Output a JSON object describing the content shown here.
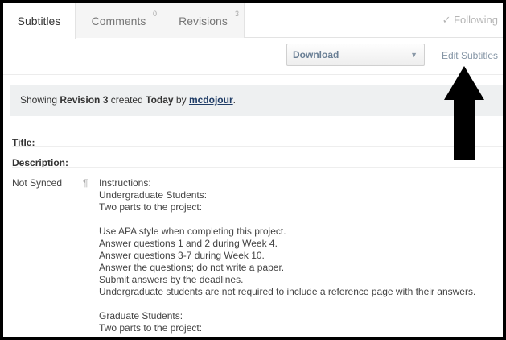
{
  "tabs": [
    {
      "label": "Subtitles",
      "count": ""
    },
    {
      "label": "Comments",
      "count": "0"
    },
    {
      "label": "Revisions",
      "count": "3"
    }
  ],
  "following": "✓ Following",
  "toolbar": {
    "download_label": "Download",
    "edit_label": "Edit Subtitles"
  },
  "revision": {
    "prefix": "Showing",
    "revision": "Revision 3",
    "created": "created",
    "date": "Today",
    "by": "by",
    "user": "mcdojour",
    "suffix": "."
  },
  "fields": {
    "title_label": "Title:",
    "description_label": "Description:"
  },
  "subtitle": {
    "status": "Not Synced",
    "lines": [
      "Instructions:",
      "Undergraduate Students:",
      "Two parts to the project:",
      "",
      "Use APA style when completing this project.",
      "Answer questions 1 and 2 during Week 4.",
      "Answer questions 3-7 during Week 10.",
      "Answer the questions; do not write a paper.",
      "Submit answers by the deadlines.",
      "Undergraduate students are not required to include a reference page with their answers.",
      "",
      "Graduate Students:",
      "Two parts to the project:"
    ]
  },
  "colors": {
    "arrow": "#000000",
    "link": "#1f3c66",
    "revision_bg": "#eef0f1"
  }
}
